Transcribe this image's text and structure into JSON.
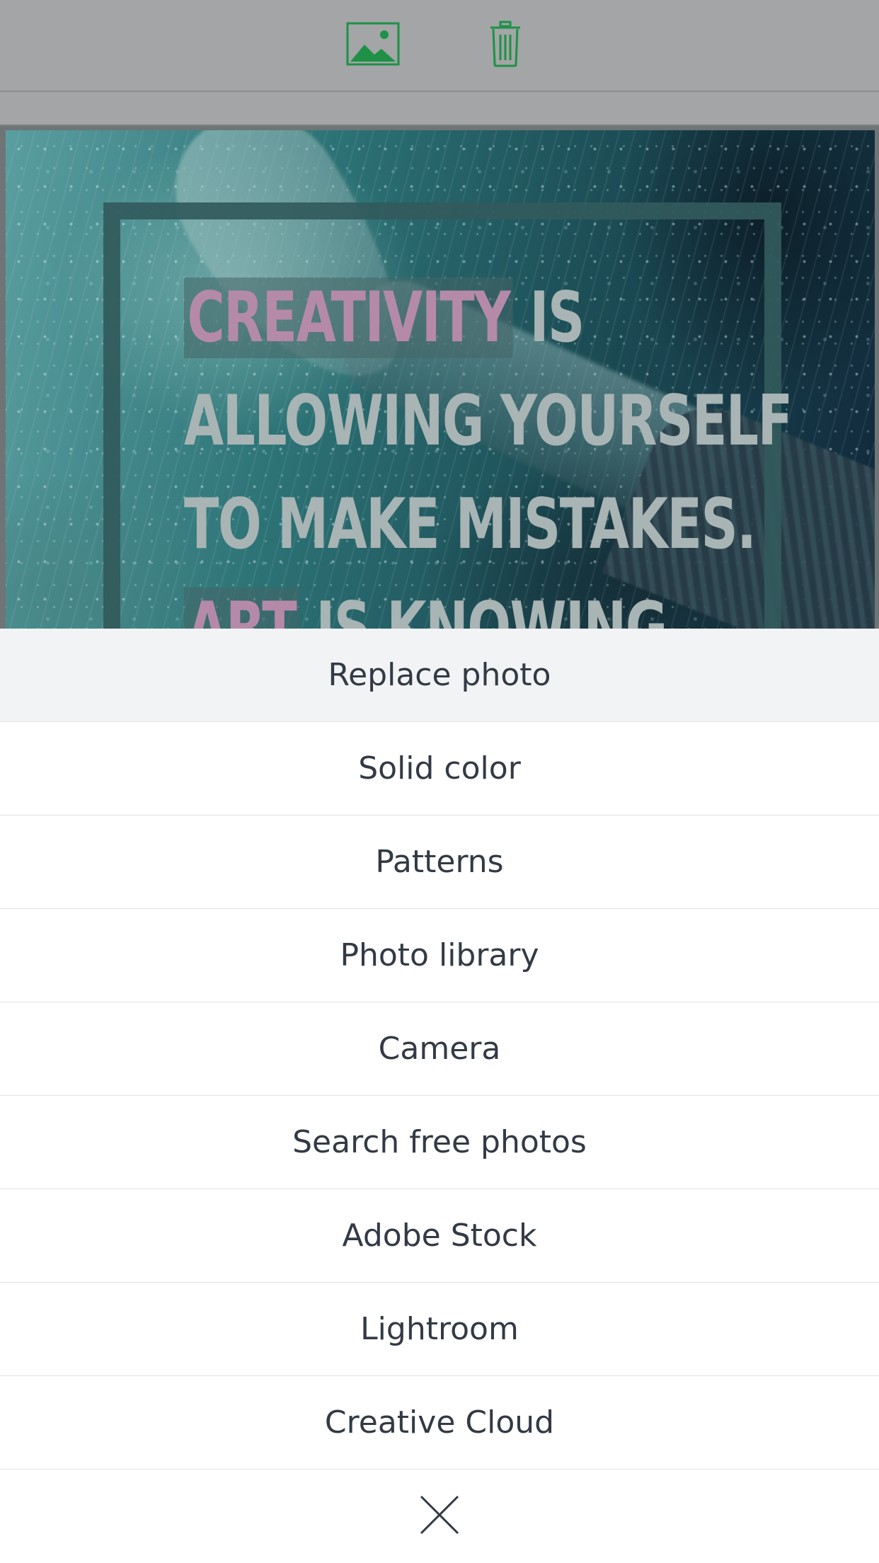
{
  "toolbar": {
    "icons": [
      "image-icon",
      "trash-icon"
    ],
    "accent_color": "#1e9146"
  },
  "canvas": {
    "quote_lines": [
      {
        "highlight": "CREATIVITY",
        "rest": " IS"
      },
      {
        "highlight": "",
        "rest": "ALLOWING YOURSELF"
      },
      {
        "highlight": "",
        "rest": "TO MAKE MISTAKES."
      },
      {
        "highlight": "ART",
        "rest": " IS KNOWING"
      }
    ],
    "text_color": "#a9b4b4",
    "highlight_color": "#b58aa8"
  },
  "sheet": {
    "items": [
      "Replace photo",
      "Solid color",
      "Patterns",
      "Photo library",
      "Camera",
      "Search free photos",
      "Adobe Stock",
      "Lightroom",
      "Creative Cloud"
    ],
    "close_icon": "close-icon"
  }
}
